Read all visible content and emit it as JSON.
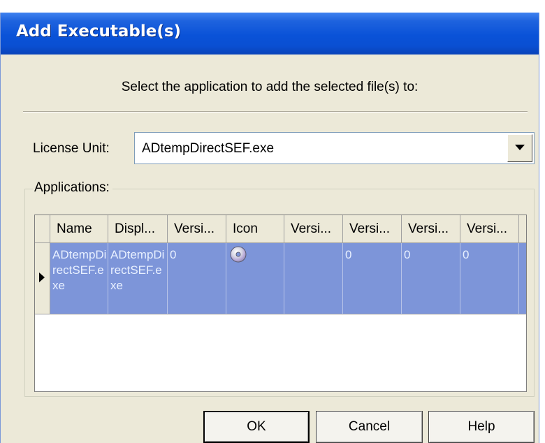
{
  "window": {
    "title": "Add Executable(s)"
  },
  "prompt": "Select the application to add the selected file(s) to:",
  "license_unit": {
    "label": "License Unit:",
    "value": "ADtempDirectSEF.exe"
  },
  "applications": {
    "label": "Applications:",
    "columns": [
      "Name",
      "Displ...",
      "Versi...",
      "Icon",
      "Versi...",
      "Versi...",
      "Versi...",
      "Versi..."
    ],
    "rows": [
      {
        "name": "ADtempDirectSEF.exe",
        "display": "ADtempDirectSEF.exe",
        "version1": "0",
        "icon": "cd-icon",
        "version2": "",
        "version3": "0",
        "version4": "0",
        "version5": "0"
      }
    ]
  },
  "buttons": {
    "ok": "OK",
    "cancel": "Cancel",
    "help": "Help"
  },
  "colors": {
    "selection": "#7d95d9",
    "titlebar": "#0a52d8",
    "dialog_bg": "#ece9d8"
  }
}
